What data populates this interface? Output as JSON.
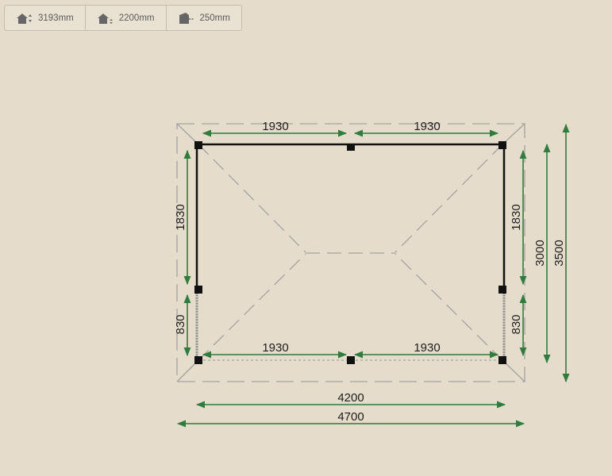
{
  "toolbar": {
    "items": [
      {
        "icon": "roof-height-icon",
        "value": "3193mm"
      },
      {
        "icon": "wall-height-icon",
        "value": "2200mm"
      },
      {
        "icon": "overhang-icon",
        "value": "250mm"
      }
    ]
  },
  "plan": {
    "top_left_span": "1930",
    "top_right_span": "1930",
    "bottom_left_span": "1930",
    "bottom_right_span": "1930",
    "left_upper": "1830",
    "left_lower": "830",
    "right_upper": "1830",
    "right_lower": "830",
    "depth_inner": "3000",
    "depth_outer": "3500",
    "width_inner": "4200",
    "width_outer": "4700",
    "colors": {
      "dimension_line": "#2e7d3e",
      "structure": "#111111",
      "roof_outline": "#9c9c9c",
      "background": "#e5dccb"
    }
  }
}
